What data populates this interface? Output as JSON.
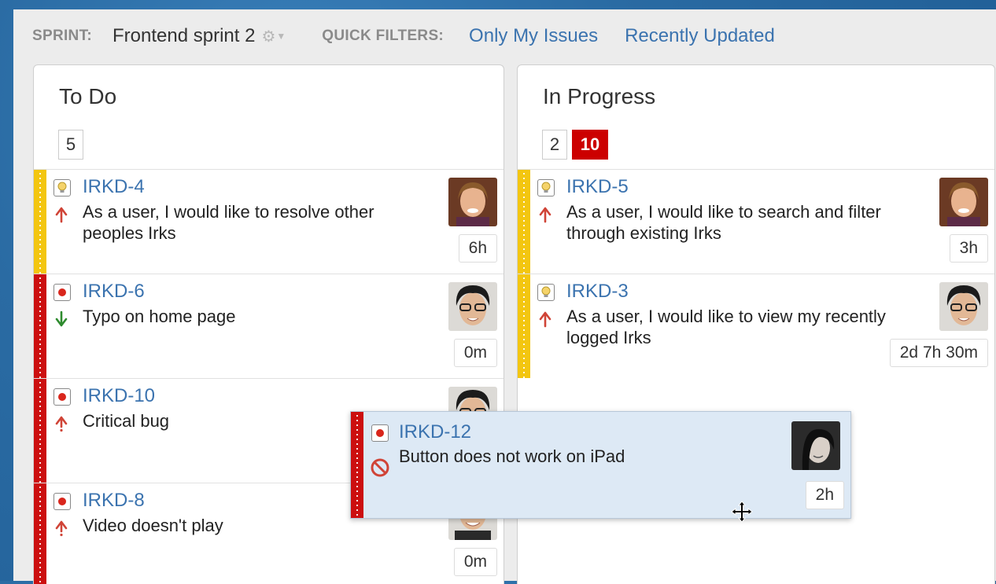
{
  "toolbar": {
    "sprint_label": "SPRINT:",
    "sprint_name": "Frontend sprint 2",
    "quick_filters_label": "QUICK FILTERS:",
    "filters": [
      "Only My Issues",
      "Recently Updated"
    ]
  },
  "columns": [
    {
      "title": "To Do",
      "count": "5",
      "cards": [
        {
          "key": "IRKD-4",
          "type": "story",
          "priority": "major-up",
          "summary": "As a user, I would like to resolve other peoples Irks",
          "estimate": "6h",
          "color": "#f3c610"
        },
        {
          "key": "IRKD-6",
          "type": "bug",
          "priority": "minor-down",
          "summary": "Typo on home page",
          "estimate": "0m",
          "color": "#cc0f0f"
        },
        {
          "key": "IRKD-10",
          "type": "bug",
          "priority": "critical-up",
          "summary": "Critical bug",
          "estimate": "",
          "color": "#cc0f0f"
        },
        {
          "key": "IRKD-8",
          "type": "bug",
          "priority": "critical-up",
          "summary": "Video doesn't play",
          "estimate": "0m",
          "color": "#cc0f0f"
        }
      ]
    },
    {
      "title": "In Progress",
      "count": "2",
      "max": "10",
      "cards": [
        {
          "key": "IRKD-5",
          "type": "story",
          "priority": "major-up",
          "summary": "As a user, I would like to search and filter through existing Irks",
          "estimate": "3h",
          "color": "#f3c610"
        },
        {
          "key": "IRKD-3",
          "type": "story",
          "priority": "major-up",
          "summary": "As a user, I would like to view my recently logged Irks",
          "estimate": "2d 7h 30m",
          "color": "#f3c610"
        }
      ]
    }
  ],
  "dragging_card": {
    "key": "IRKD-12",
    "type": "bug",
    "priority": "blocker",
    "summary": "Button does not work on iPad",
    "estimate": "2h",
    "color": "#cc0f0f"
  }
}
